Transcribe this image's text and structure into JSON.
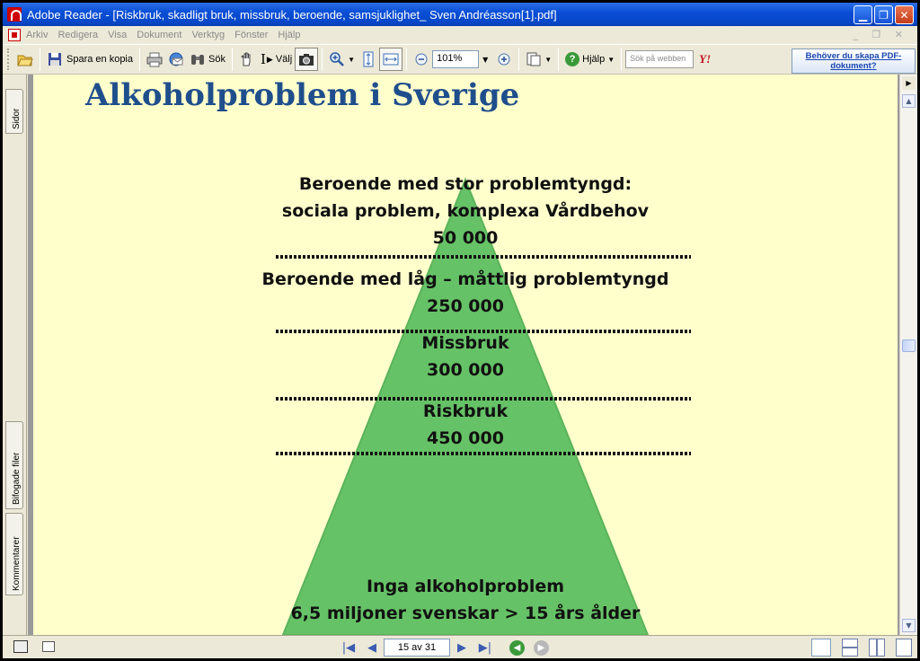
{
  "window": {
    "title": "Adobe Reader - [Riskbruk, skadligt bruk, missbruk, beroende, samsjuklighet_ Sven Andréasson[1].pdf]"
  },
  "menu": {
    "items": [
      "Arkiv",
      "Redigera",
      "Visa",
      "Dokument",
      "Verktyg",
      "Fönster",
      "Hjälp"
    ]
  },
  "toolbar": {
    "save_copy": "Spara en kopia",
    "search": "Sök",
    "select": "Välj",
    "zoom_value": "101%",
    "help": "Hjälp",
    "web_search_placeholder": "Sök på webben",
    "yahoo": "Y!",
    "ad_text": "Behöver du skapa PDF-dokument?"
  },
  "left_panel": {
    "tabs": [
      "Sidor",
      "Bifogade filer",
      "Kommentarer"
    ]
  },
  "slide": {
    "title": "Alkoholproblem i Sverige",
    "levels": [
      {
        "line1": "Beroende med stor problemtyngd:",
        "line2": "sociala problem, komplexa Vårdbehov",
        "count": "50 000"
      },
      {
        "line1": "Beroende med låg – måttlig problemtyngd",
        "count": "250 000"
      },
      {
        "line1": "Missbruk",
        "count": "300 000"
      },
      {
        "line1": "Riskbruk",
        "count": "450 000"
      },
      {
        "line1": "Inga alkoholproblem",
        "line2": "6,5 miljoner svenskar > 15 års ålder"
      }
    ],
    "colors": {
      "pyramid": "#66c266",
      "pyramid_edge": "#5ab35a",
      "title": "#1f4e8c",
      "background": "#ffffcc"
    }
  },
  "statusbar": {
    "page_indicator": "15 av 31"
  }
}
